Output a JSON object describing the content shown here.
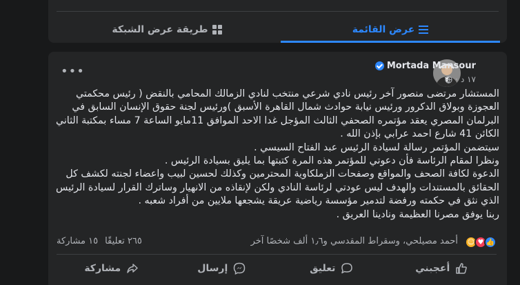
{
  "view_tabs": {
    "list_label": "عرض القائمة",
    "grid_label": "طريقة عرض الشبكة"
  },
  "post": {
    "author": "Mortada Mansour",
    "time": "١٧ د",
    "lines": [
      "المستشار مرتضى منصور آخر رئيس نادي شرعي منتخب لنادي الزمالك المحامي بالنقض ( رئيس محكمتي",
      "العجوزة وبولاق الدكرور ورئيس نيابة حوادث شمال القاهرة الأسبق )ورئيس لجنة حقوق الإنسان السابق في",
      "البرلمان المصري يعقد مؤتمره الصحفي الثالث المؤجل غدا الاحد الموافق 11مايو الساعة 7 مساء بمكتبة الثاني",
      "الكائن 41 شارع احمد عرابي بإذن الله .",
      "سيتضمن المؤتمر  رسالة لسيادة الرئيس عبد الفتاح السيسي .",
      "ونظرا لمقام الرئاسة فأن دعوتي للمؤتمر هذه المرة كتبتها بما يليق بسيادة الرئيس .",
      "الدعوة لكافة الصحف والمواقع وصفحات الزملكاوية المحترمين وكذلك لحسين لبيب واعضاء لجنته لكشف كل",
      "الحقائق بالمستندات والهدف ليس عودتي لرئاسة النادي ولكن لإنقاذه من الانهيار وساترك القرار لسيادة الرئيس",
      "الذي نثق في حكمته ورفضة لتدمير مؤسسة رياضية عريقة يشجعها ملايين من أفراد شعبه .",
      "ربنا يوفق مصرنا العظيمة ونادينا العريق ."
    ],
    "reactions_text": "أحمد مصيلحي، وسقراط المقدسي و١٫٦ ألف شخصًا آخر",
    "comments_count": "٢٦٥ تعليقًا",
    "shares_count": "١٥ مشاركة"
  },
  "actions": {
    "like": "أعجبني",
    "comment": "تعليق",
    "send": "إرسال",
    "share": "مشاركة"
  },
  "colors": {
    "background": "#18191a",
    "card": "#242526",
    "accent": "#2d88ff",
    "text": "#e4e6eb",
    "muted": "#b0b3b8"
  }
}
